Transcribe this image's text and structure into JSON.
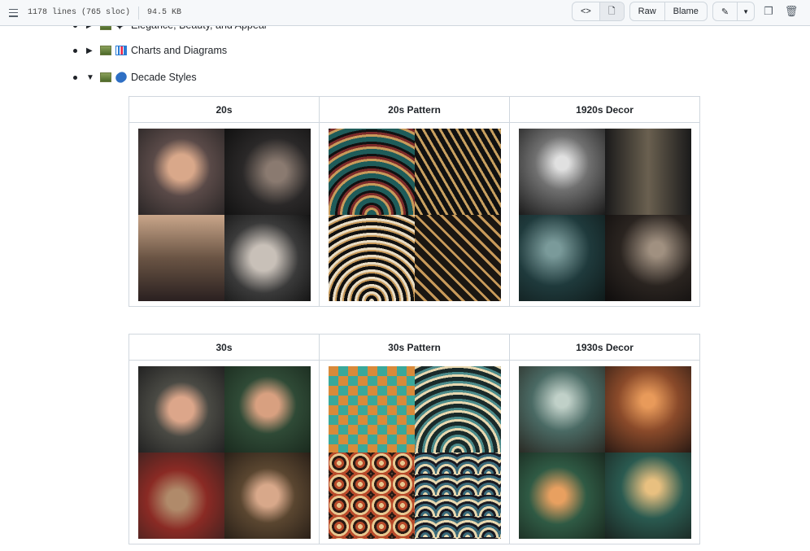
{
  "header": {
    "lines": "1178 lines (765 sloc)",
    "size": "94.5 KB",
    "code_icon": "code-icon",
    "preview_icon": "file-icon",
    "raw": "Raw",
    "blame": "Blame",
    "edit_icon": "pencil-icon",
    "more_icon": "triangle-down-icon",
    "copy_icon": "copy-icon",
    "delete_icon": "trash-icon"
  },
  "list": [
    {
      "label": "Elegance, Beauty, and Appeal",
      "expanded": false
    },
    {
      "label": "Charts and Diagrams",
      "expanded": false
    },
    {
      "label": "Decade Styles",
      "expanded": true
    }
  ],
  "tables": [
    {
      "headers": [
        "20s",
        "20s Pattern",
        "1920s Decor"
      ]
    },
    {
      "headers": [
        "30s",
        "30s Pattern",
        "1930s Decor"
      ]
    }
  ]
}
